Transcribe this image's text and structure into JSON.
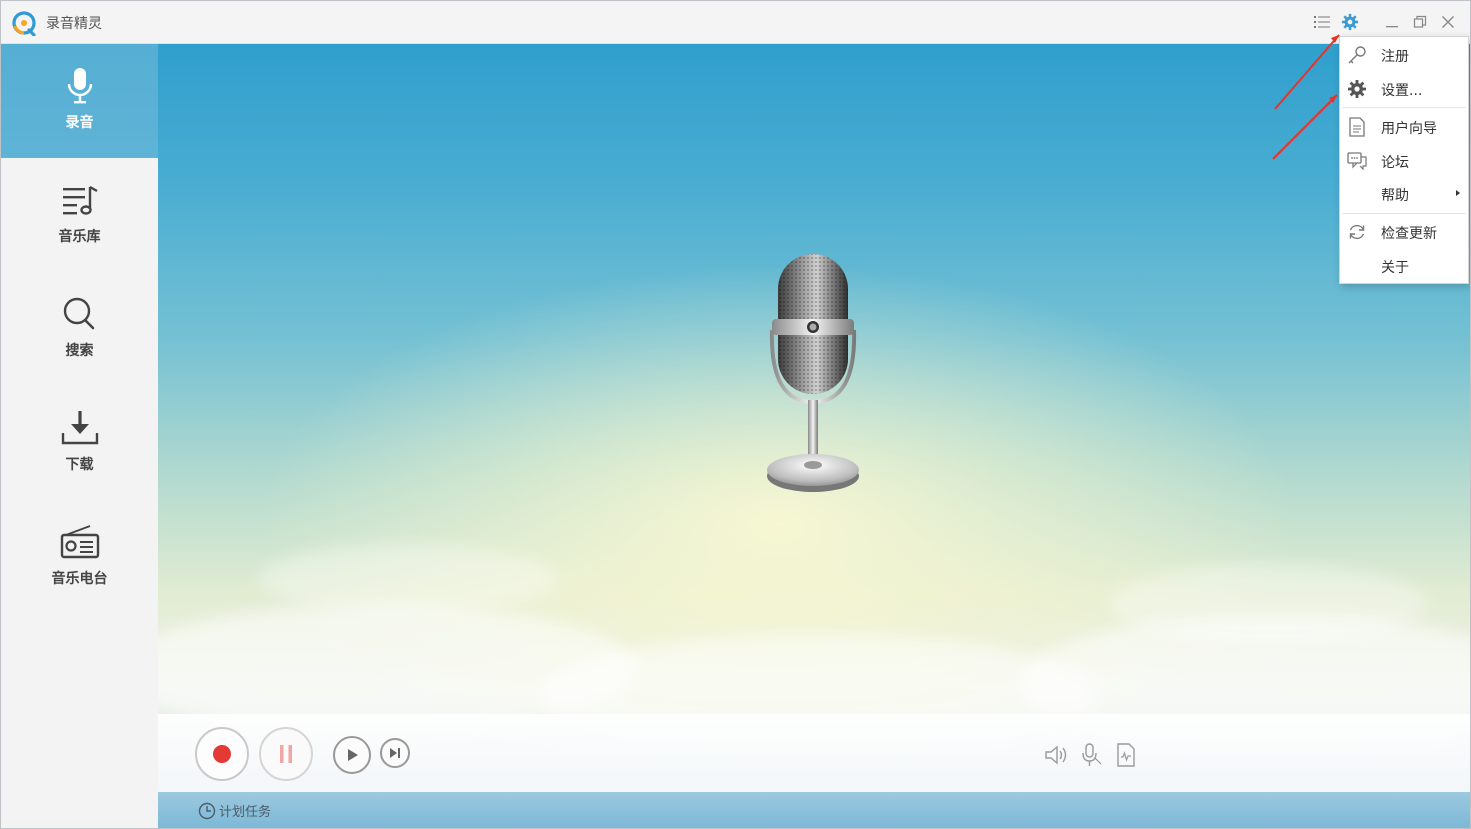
{
  "window": {
    "title": "录音精灵"
  },
  "sidebar": {
    "items": [
      {
        "label": "录音",
        "icon": "microphone-icon",
        "active": true
      },
      {
        "label": "音乐库",
        "icon": "music-library-icon",
        "active": false
      },
      {
        "label": "搜索",
        "icon": "search-icon",
        "active": false
      },
      {
        "label": "下载",
        "icon": "download-icon",
        "active": false
      },
      {
        "label": "音乐电台",
        "icon": "radio-icon",
        "active": false
      }
    ]
  },
  "menu": {
    "items": [
      {
        "label": "注册",
        "icon": "key-icon"
      },
      {
        "label": "设置...",
        "icon": "gear-icon"
      },
      {
        "label": "用户向导",
        "icon": "document-icon"
      },
      {
        "label": "论坛",
        "icon": "chat-icon"
      },
      {
        "label": "帮助",
        "icon": "",
        "has_submenu": true
      },
      {
        "label": "检查更新",
        "icon": "refresh-icon"
      },
      {
        "label": "关于",
        "icon": ""
      }
    ]
  },
  "controls": {
    "schedule_label": "计划任务"
  },
  "colors": {
    "accent": "#5fb4d6",
    "record_red": "#e53935",
    "annotation_red": "#e8322a",
    "gear_blue": "#3a9bd4"
  }
}
